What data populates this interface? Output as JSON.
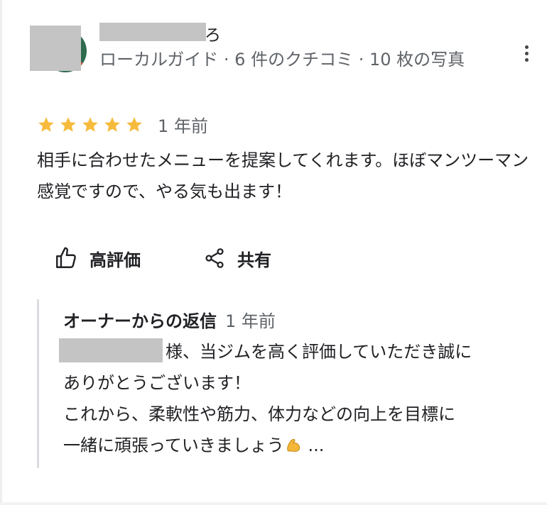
{
  "reviewer": {
    "name_visible_suffix": "ろ",
    "meta": "ローカルガイド · 6 件のクチコミ · 10 枚の写真"
  },
  "review": {
    "rating": 5,
    "rating_max": 5,
    "time": "1 年前",
    "text": "相手に合わせたメニューを提案してくれます。ほぼマンツーマン感覚ですので、やる気も出ます！"
  },
  "actions": {
    "like_label": "高評価",
    "share_label": "共有"
  },
  "owner_reply": {
    "heading": "オーナーからの返信",
    "time": "1 年前",
    "line1": "様、当ジムを高く評価していただき誠に",
    "line2": "ありがとうございます！",
    "line3": "これから、柔軟性や筋力、体力などの向上を目標に",
    "line4": "一緒に頑張っていきましょう",
    "ellipsis": " ..."
  },
  "colors": {
    "star": "#f6bb3d",
    "secondary_text": "#5f6368",
    "primary_text": "#202124"
  },
  "icons": [
    "more-vert-icon",
    "star-icon",
    "thumbs-up-icon",
    "share-icon",
    "flexed-biceps-icon"
  ]
}
